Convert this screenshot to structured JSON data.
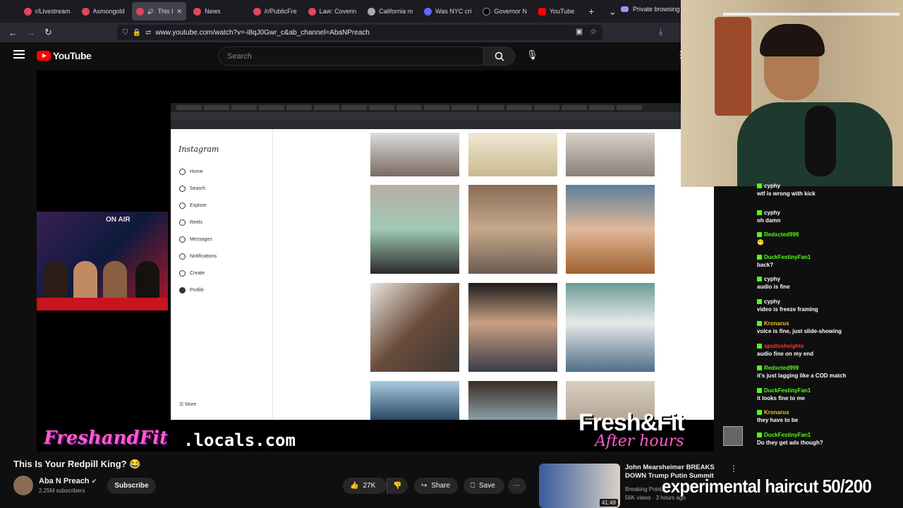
{
  "browser": {
    "tabs": [
      {
        "label": "r/Livestream",
        "icon": "reddit-icon"
      },
      {
        "label": "Asmongold",
        "icon": "reddit-icon"
      },
      {
        "label": "This I",
        "icon": "youtube-icon",
        "active": true
      },
      {
        "label": "News",
        "icon": "reddit-icon"
      },
      {
        "label": "/r/PublicFre",
        "icon": "reddit-icon"
      },
      {
        "label": "Law: Coverin",
        "icon": "reddit-icon"
      },
      {
        "label": "California m",
        "icon": "ap-icon"
      },
      {
        "label": "Was NYC cri",
        "icon": "yahoo-icon"
      },
      {
        "label": "Governor N",
        "icon": "x-icon"
      },
      {
        "label": "YouTube",
        "icon": "youtube-icon"
      }
    ],
    "private_label": "Private browsing",
    "url": "www.youtube.com/watch?v=-i8qJ0Gwr_c&ab_channel=AbaNPreach"
  },
  "youtube": {
    "logo_text": "YouTube",
    "search_placeholder": "Search"
  },
  "video": {
    "instagram_logo": "Instagram",
    "instagram_nav": [
      "Home",
      "Search",
      "Explore",
      "Reels",
      "Messages",
      "Notifications",
      "Create",
      "Profile"
    ],
    "instagram_more": "More",
    "pip_label": "ON AIR",
    "freshandfit": "FreshandFit",
    "locals": ".locals.com",
    "fresh_fit": "Fresh&Fit",
    "after_hours": "After hours"
  },
  "chat": [
    {
      "user": "cyphy",
      "color": "#ffffff",
      "text": "wtf is wrong with kick"
    },
    {
      "user": "cyphy",
      "color": "#ffffff",
      "text": "oh damn"
    },
    {
      "user": "Redxcted999",
      "color": "#53fc18",
      "text": "😬"
    },
    {
      "user": "DuckFestinyFan1",
      "color": "#53fc18",
      "text": "back?"
    },
    {
      "user": "cyphy",
      "color": "#ffffff",
      "text": "audio is fine"
    },
    {
      "user": "cyphy",
      "color": "#ffffff",
      "text": "video is freeze framing"
    },
    {
      "user": "Kronarus",
      "color": "#f0c419",
      "text": "voice is fine, just slide-showing"
    },
    {
      "user": "apollosheights",
      "color": "#ff3333",
      "text": "audio fine on my end"
    },
    {
      "user": "Redxcted999",
      "color": "#53fc18",
      "text": "it's just lagging like a COD match"
    },
    {
      "user": "DuckFestinyFan1",
      "color": "#53fc18",
      "text": "it looks fine to me"
    },
    {
      "user": "Kronarus",
      "color": "#f0c419",
      "text": "they have to be"
    },
    {
      "user": "DuckFestinyFan1",
      "color": "#53fc18",
      "text": "Do they get ads though?"
    }
  ],
  "meta": {
    "title": "This Is Your Redpill King? 😂",
    "channel": "Aba N Preach",
    "subscribers": "2.25M subscribers",
    "subscribe_label": "Subscribe",
    "likes": "27K",
    "share_label": "Share",
    "save_label": "Save"
  },
  "recommendation": {
    "title": "John Mearsheimer BREAKS DOWN Trump Putin Summit",
    "channel": "Breaking Points",
    "stats": "56K views · 3 hours ago",
    "duration": "41:49"
  },
  "overlay_text": "experimental haircut 50/200",
  "colors": {
    "accent": "#ff0000",
    "kick_green": "#53fc18",
    "pink": "#ff5cc9"
  }
}
